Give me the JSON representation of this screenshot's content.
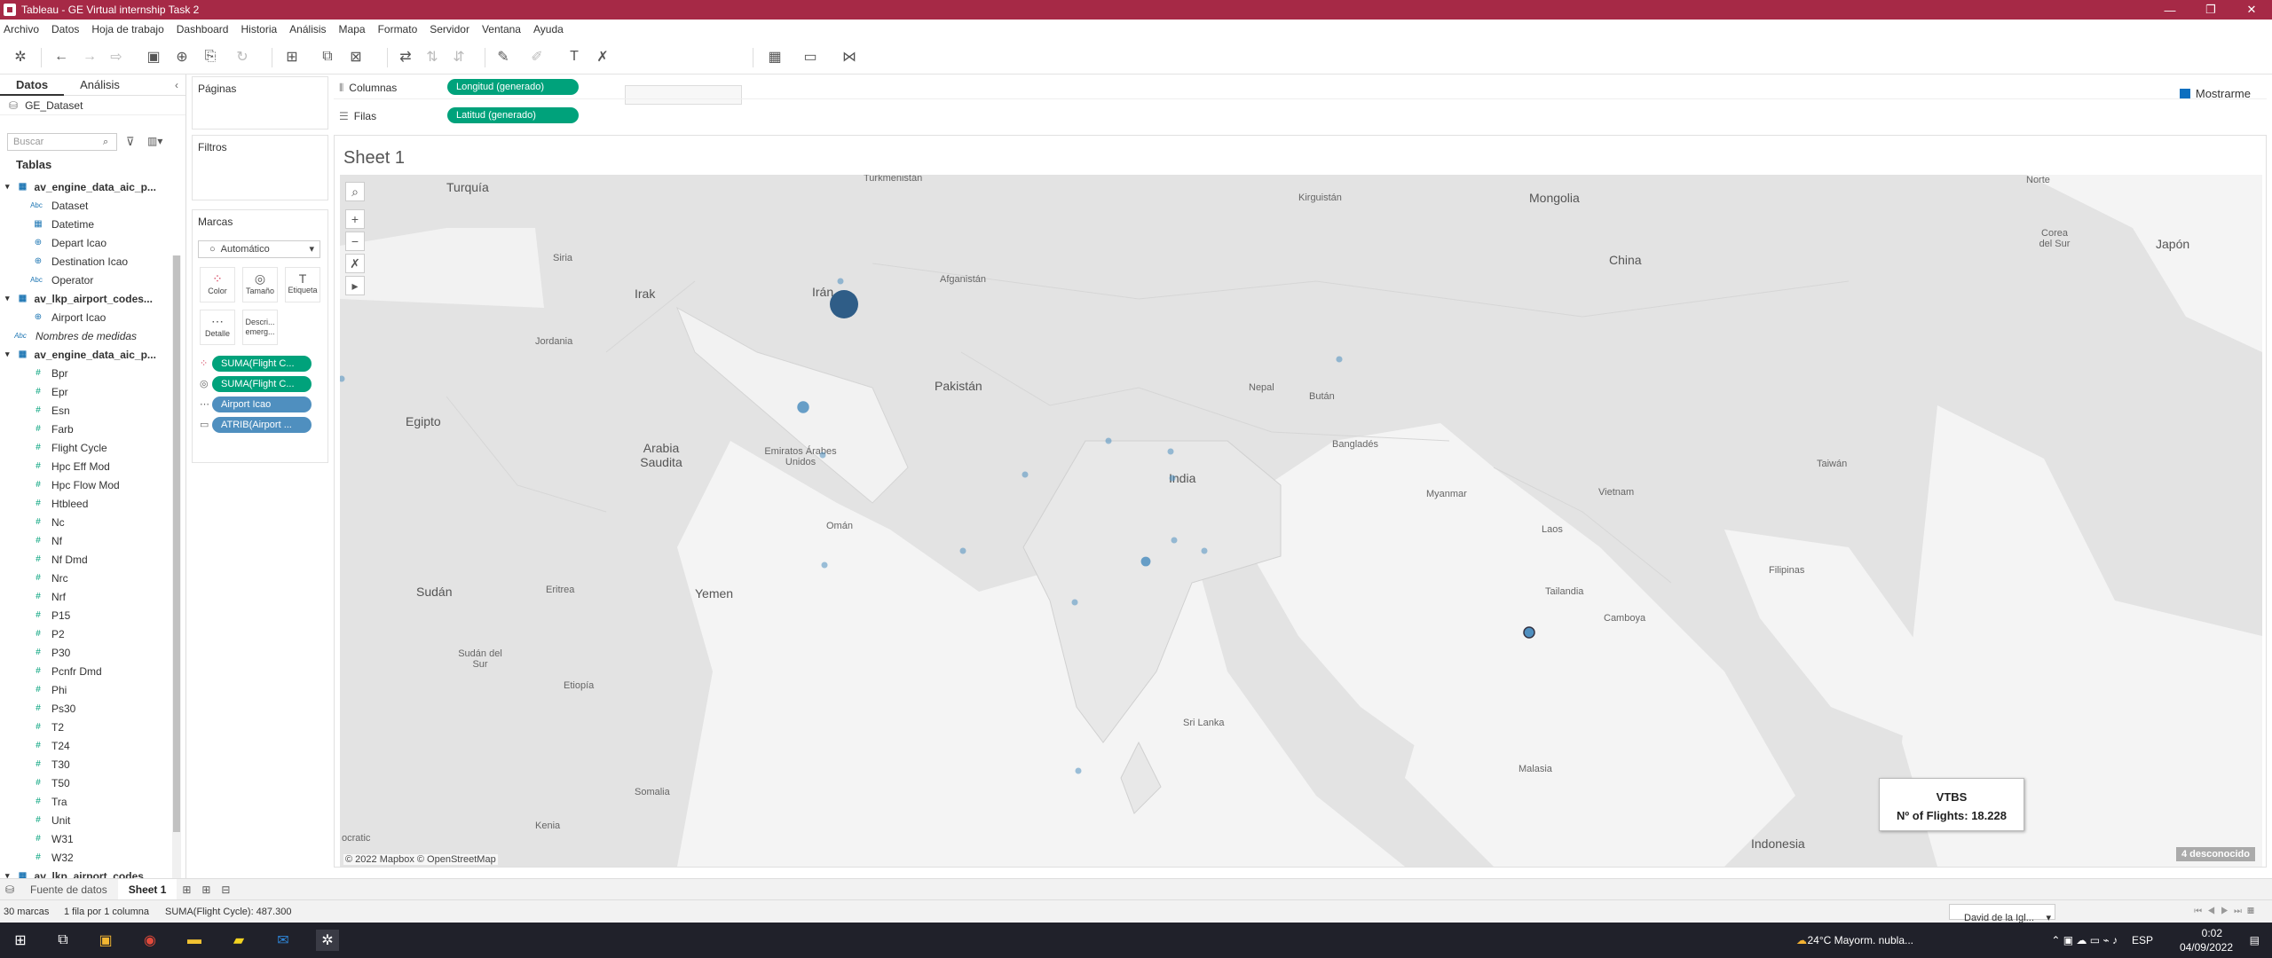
{
  "window": {
    "title": "Tableau - GE Virtual internship Task 2",
    "min": "—",
    "max": "❐",
    "close": "✕"
  },
  "menu": [
    "Archivo",
    "Datos",
    "Hoja de trabajo",
    "Dashboard",
    "Historia",
    "Análisis",
    "Mapa",
    "Formato",
    "Servidor",
    "Ventana",
    "Ayuda"
  ],
  "toolbar": {
    "show_me": "Mostrarme"
  },
  "data_pane": {
    "tabs": [
      "Datos",
      "Análisis"
    ],
    "datasource": "GE_Dataset",
    "search_placeholder": "Buscar",
    "tables_header": "Tablas",
    "fields": [
      {
        "kind": "table",
        "label": "av_engine_data_aic_p..."
      },
      {
        "kind": "field",
        "type": "abc",
        "label": "Dataset"
      },
      {
        "kind": "field",
        "type": "date",
        "label": "Datetime"
      },
      {
        "kind": "field",
        "type": "geo",
        "label": "Depart Icao"
      },
      {
        "kind": "field",
        "type": "geo",
        "label": "Destination Icao"
      },
      {
        "kind": "field",
        "type": "abc",
        "label": "Operator"
      },
      {
        "kind": "table",
        "label": "av_lkp_airport_codes..."
      },
      {
        "kind": "field",
        "type": "geo",
        "label": "Airport Icao"
      },
      {
        "kind": "italic",
        "type": "abc",
        "label": "Nombres de medidas"
      },
      {
        "kind": "table",
        "label": "av_engine_data_aic_p..."
      },
      {
        "kind": "measure",
        "label": "Bpr"
      },
      {
        "kind": "measure",
        "label": "Epr"
      },
      {
        "kind": "measure",
        "label": "Esn"
      },
      {
        "kind": "measure",
        "label": "Farb"
      },
      {
        "kind": "measure",
        "label": "Flight Cycle"
      },
      {
        "kind": "measure",
        "label": "Hpc Eff Mod"
      },
      {
        "kind": "measure",
        "label": "Hpc Flow Mod"
      },
      {
        "kind": "measure",
        "label": "Htbleed"
      },
      {
        "kind": "measure",
        "label": "Nc"
      },
      {
        "kind": "measure",
        "label": "Nf"
      },
      {
        "kind": "measure",
        "label": "Nf Dmd"
      },
      {
        "kind": "measure",
        "label": "Nrc"
      },
      {
        "kind": "measure",
        "label": "Nrf"
      },
      {
        "kind": "measure",
        "label": "P15"
      },
      {
        "kind": "measure",
        "label": "P2"
      },
      {
        "kind": "measure",
        "label": "P30"
      },
      {
        "kind": "measure",
        "label": "Pcnfr Dmd"
      },
      {
        "kind": "measure",
        "label": "Phi"
      },
      {
        "kind": "measure",
        "label": "Ps30"
      },
      {
        "kind": "measure",
        "label": "T2"
      },
      {
        "kind": "measure",
        "label": "T24"
      },
      {
        "kind": "measure",
        "label": "T30"
      },
      {
        "kind": "measure",
        "label": "T50"
      },
      {
        "kind": "measure",
        "label": "Tra"
      },
      {
        "kind": "measure",
        "label": "Unit"
      },
      {
        "kind": "measure",
        "label": "W31"
      },
      {
        "kind": "measure",
        "label": "W32"
      },
      {
        "kind": "table",
        "label": "av_lkp_airport_codes..."
      }
    ]
  },
  "shelves": {
    "pages": "Páginas",
    "filters": "Filtros",
    "marks": "Marcas",
    "mark_type": "Automático",
    "mark_buttons": [
      "Color",
      "Tamaño",
      "Etiqueta",
      "Detalle",
      "Descri... emerg..."
    ],
    "mark_pills": [
      "SUMA(Flight C...",
      "SUMA(Flight C...",
      "Airport Icao",
      "ATRIB(Airport ..."
    ],
    "columns_label": "Columnas",
    "columns_pill": "Longitud (generado)",
    "rows_label": "Filas",
    "rows_pill": "Latitud (generado)"
  },
  "sheet": {
    "title": "Sheet 1",
    "map_labels": [
      "Turquía",
      "Turkmenistán",
      "Kirguistán",
      "Mongolia",
      "Norte",
      "Corea del Sur",
      "Japón",
      "China",
      "Siria",
      "Irak",
      "Irán",
      "Afganistán",
      "Jordania",
      "Pakistán",
      "Nepal",
      "Bután",
      "Egipto",
      "Arabia Saudita",
      "Emiratos Árabes Unidos",
      "India",
      "Bangladés",
      "Taiwán",
      "Omán",
      "Myanmar",
      "Laos",
      "Vietnam",
      "Filipinas",
      "Sudán",
      "Eritrea",
      "Yemen",
      "Tailandia",
      "Camboya",
      "Sudán del Sur",
      "Etiopía",
      "Sri Lanka",
      "Somalia",
      "Malasia",
      "Kenia",
      "Indonesia",
      "ocratic"
    ],
    "tooltip": {
      "code": "VTBS",
      "text": "Nº of Flights: 18.228"
    },
    "credit": "© 2022 Mapbox © OpenStreetMap",
    "unknown_badge": "4 desconocido",
    "point_color": "#4f8fbf",
    "points_flights": [
      18228,
      3200,
      2100,
      900,
      700,
      600,
      400,
      300,
      250,
      200,
      200,
      180,
      150,
      140,
      120,
      100,
      90
    ]
  },
  "bottom": {
    "datasource_tab": "Fuente de datos",
    "sheet_tab": "Sheet 1",
    "status_marks": "30 marcas",
    "status_dims": "1 fila por 1 columna",
    "status_sum": "SUMA(Flight Cycle): 487.300",
    "user": "David de la Igl..."
  },
  "taskbar": {
    "weather": "24°C  Mayorm. nubla...",
    "lang": "ESP",
    "time": "0:02",
    "date": "04/09/2022"
  },
  "colors": {
    "title_bar": "#a62946",
    "pill_green": "#00a27b",
    "pill_blue": "#4f8fbf",
    "mark_dark": "#2f5d87"
  }
}
